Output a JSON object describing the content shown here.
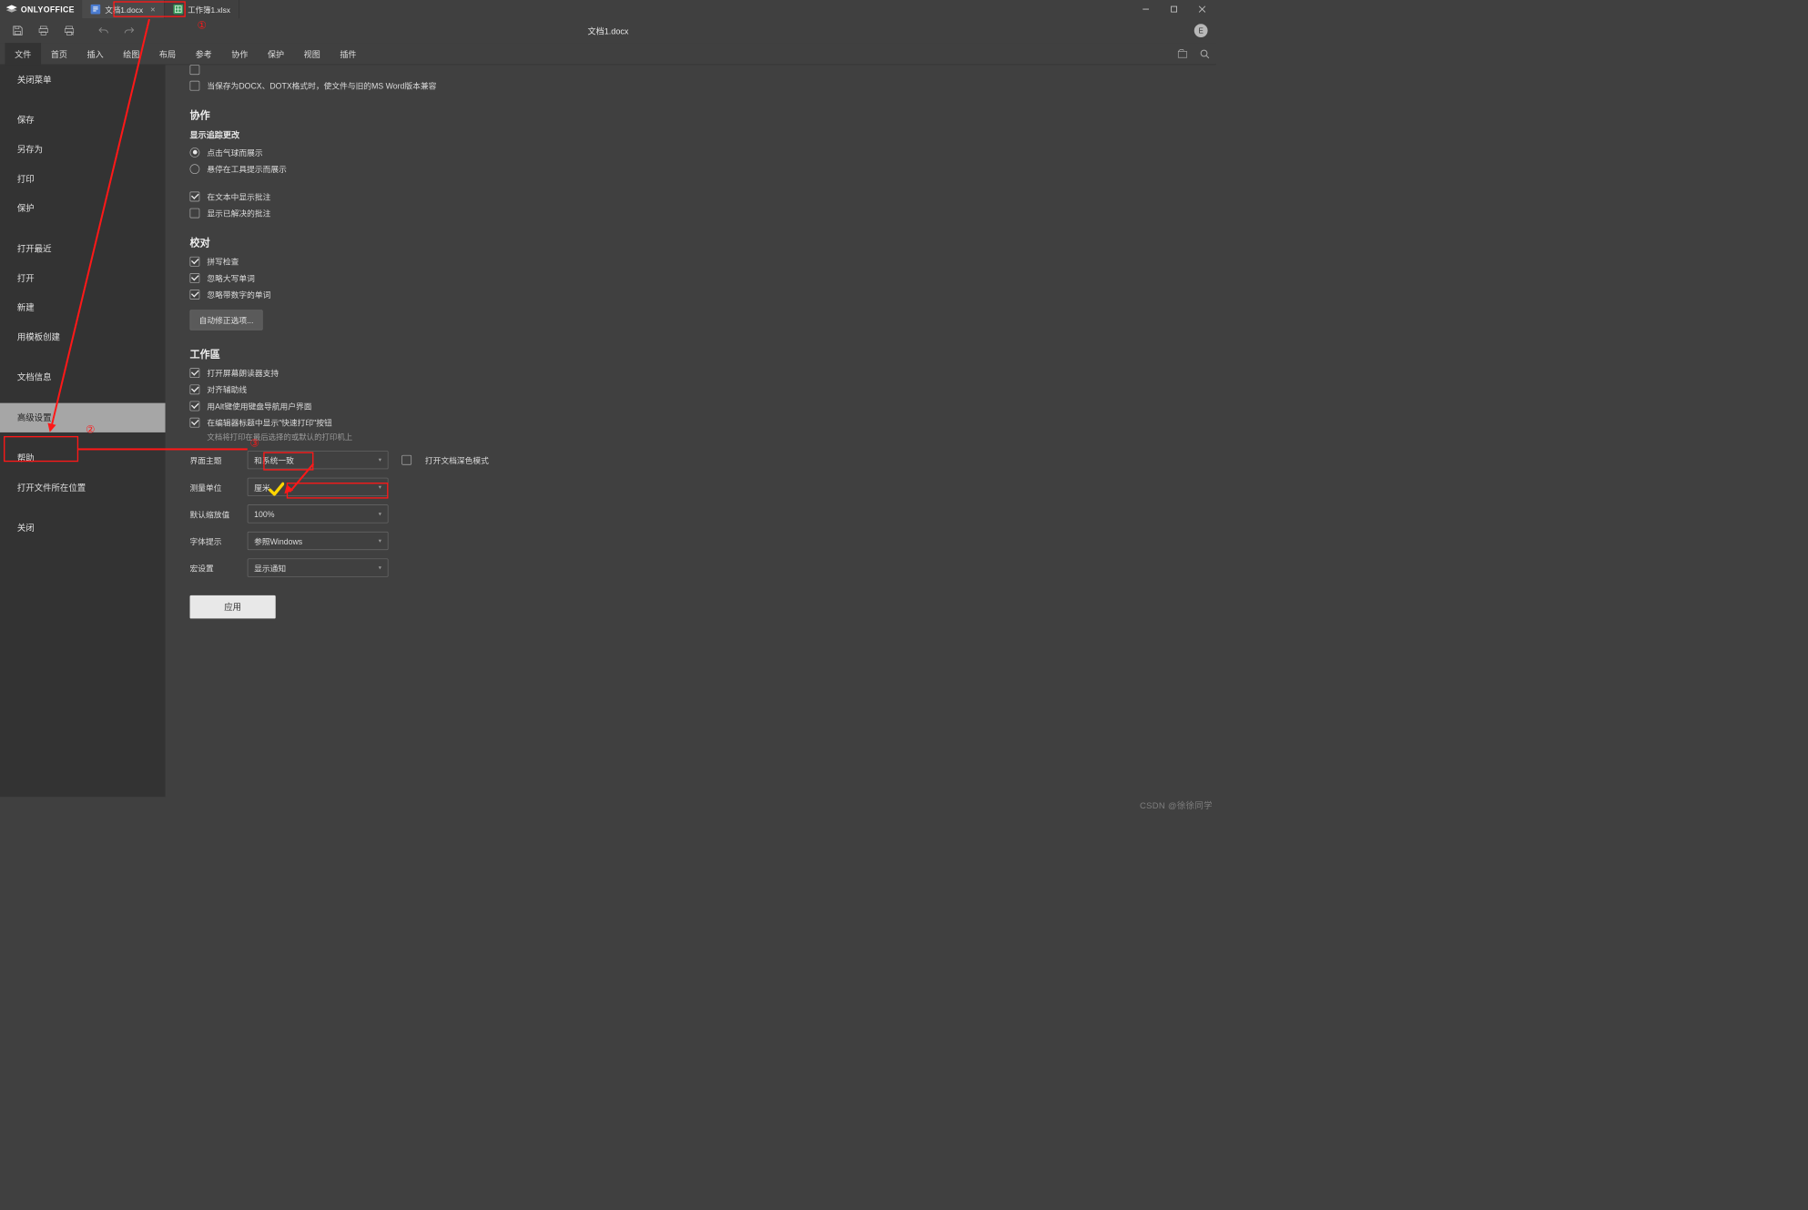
{
  "app": {
    "name": "ONLYOFFICE"
  },
  "tabs": [
    {
      "label": "文档1.docx",
      "active": true,
      "kind": "doc"
    },
    {
      "label": "工作簿1.xlsx",
      "active": false,
      "kind": "sheet"
    }
  ],
  "window": {
    "title_center": "文档1.docx",
    "user_initial": "E"
  },
  "menubar": {
    "items": [
      "文件",
      "首页",
      "插入",
      "绘图",
      "布局",
      "参考",
      "协作",
      "保护",
      "视图",
      "插件"
    ],
    "active_index": 0
  },
  "sidebar": {
    "items": [
      "关闭菜单",
      "保存",
      "另存为",
      "打印",
      "保护",
      "打开最近",
      "打开",
      "新建",
      "用模板创建",
      "文档信息",
      "高级设置",
      "帮助",
      "打开文件所在位置",
      "关闭"
    ],
    "selected_index": 10
  },
  "settings": {
    "top_checkbox": {
      "label": "当保存为DOCX、DOTX格式时，使文件与旧的MS Word版本兼容",
      "checked": false
    },
    "collab": {
      "title": "协作",
      "track_title": "显示追踪更改",
      "radios": [
        {
          "label": "点击气球而展示",
          "on": true
        },
        {
          "label": "悬停在工具提示而展示",
          "on": false
        }
      ],
      "checks": [
        {
          "label": "在文本中显示批注",
          "on": true
        },
        {
          "label": "显示已解决的批注",
          "on": false
        }
      ]
    },
    "proof": {
      "title": "校对",
      "checks": [
        {
          "label": "拼写检查",
          "on": true
        },
        {
          "label": "忽略大写单词",
          "on": true
        },
        {
          "label": "忽略带数字的单词",
          "on": true
        }
      ],
      "autocorrect_btn": "自动修正选项..."
    },
    "workspace": {
      "title": "工作區",
      "checks": [
        {
          "label": "打开屏幕朗读器支持",
          "on": true
        },
        {
          "label": "对齐辅助线",
          "on": true
        },
        {
          "label": "用Alt键使用键盘导航用户界面",
          "on": true
        },
        {
          "label": "在编辑器标题中显示\"快速打印\"按钮",
          "on": true,
          "hint": "文档将打印在最后选择的或默认的打印机上"
        }
      ],
      "selects": [
        {
          "label": "界面主题",
          "value": "和系统一致",
          "extra_check": {
            "label": "打开文档深色模式",
            "on": false
          }
        },
        {
          "label": "测量单位",
          "value": "厘米"
        },
        {
          "label": "默认缩放值",
          "value": "100%"
        },
        {
          "label": "字体提示",
          "value": "参照Windows"
        },
        {
          "label": "宏设置",
          "value": "显示通知"
        }
      ]
    },
    "apply_label": "应用"
  },
  "annotations": {
    "circ1": "①",
    "circ2": "②",
    "circ3": "③"
  },
  "watermark": "CSDN @徐徐同学"
}
